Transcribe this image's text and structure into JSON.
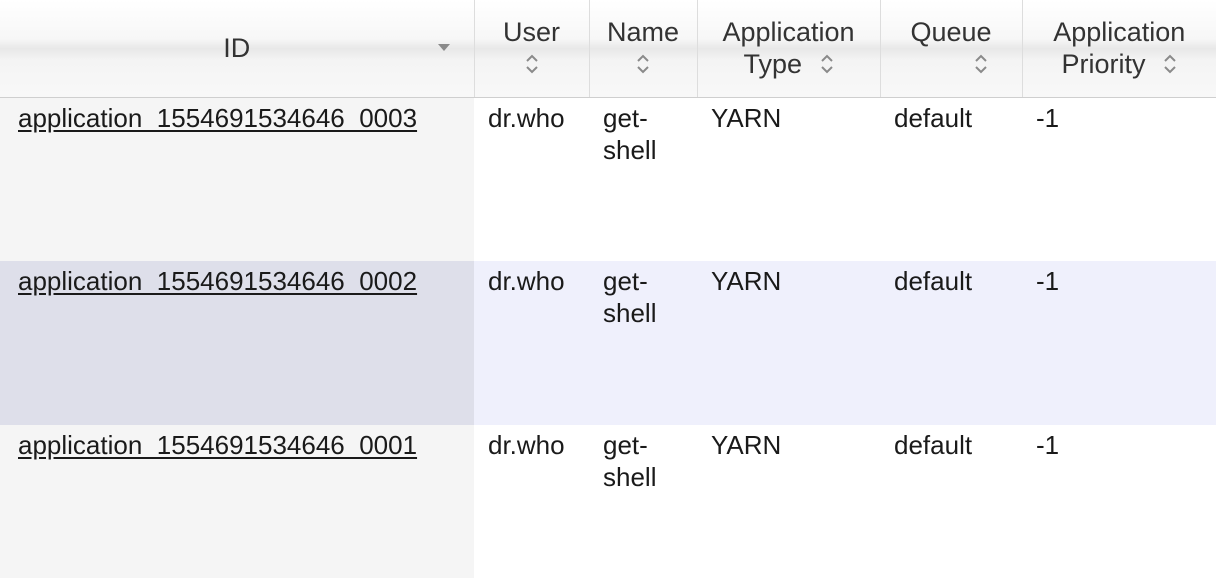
{
  "table": {
    "columns": [
      {
        "label": "ID",
        "sort": "descending"
      },
      {
        "label": "User",
        "sort": "sortable"
      },
      {
        "label": "Name",
        "sort": "sortable"
      },
      {
        "label": "Application Type",
        "sort": "sortable"
      },
      {
        "label": "Queue",
        "sort": "sortable"
      },
      {
        "label": "Application Priority",
        "sort": "sortable"
      }
    ],
    "rows": [
      {
        "id": "application_1554691534646_0003",
        "user": "dr.who",
        "name": "get-shell",
        "type": "YARN",
        "queue": "default",
        "priority": "-1"
      },
      {
        "id": "application_1554691534646_0002",
        "user": "dr.who",
        "name": "get-shell",
        "type": "YARN",
        "queue": "default",
        "priority": "-1"
      },
      {
        "id": "application_1554691534646_0001",
        "user": "dr.who",
        "name": "get-shell",
        "type": "YARN",
        "queue": "default",
        "priority": "-1"
      }
    ]
  },
  "colors": {
    "row_even_background": "#eff0fc",
    "row_even_id_background": "#dedfea",
    "row_odd_id_background": "#f5f5f5",
    "sort_icon": "#8a8a8a"
  }
}
